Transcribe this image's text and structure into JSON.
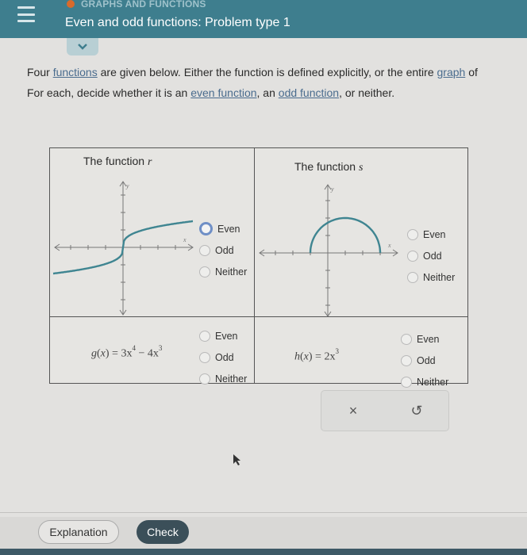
{
  "header": {
    "topic": "GRAPHS AND FUNCTIONS",
    "title": "Even and odd functions: Problem type 1",
    "menu_icon": "hamburger-menu-icon",
    "collapse_icon": "chevron-down-icon"
  },
  "intro": {
    "line1_pre": "Four ",
    "line1_link1": "functions",
    "line1_mid": " are given below. Either the function is defined explicitly, or the entire ",
    "line1_link2": "graph",
    "line1_post": " of",
    "line2_pre": "For each, decide whether it is an ",
    "line2_link1": "even function",
    "line2_mid": ", an ",
    "line2_link2": "odd function",
    "line2_post": ", or neither."
  },
  "problems": [
    {
      "label": "The function ",
      "var": "r",
      "type": "graph",
      "graph_description": "cube-root-like increasing curve through origin",
      "choices": [
        "Even",
        "Odd",
        "Neither"
      ],
      "focused_choice": "Even",
      "selected": null
    },
    {
      "label": "The function ",
      "var": "s",
      "type": "graph",
      "graph_description": "upper semicircle from x=-1 to x=3, center x=1",
      "choices": [
        "Even",
        "Odd",
        "Neither"
      ],
      "selected": null
    },
    {
      "type": "formula",
      "name": "g",
      "arg": "x",
      "expr": {
        "t1_coef": "3x",
        "t1_exp": "4",
        "op": "−",
        "t2_coef": "4x",
        "t2_exp": "3"
      },
      "choices": [
        "Even",
        "Odd",
        "Neither"
      ],
      "selected": null
    },
    {
      "type": "formula",
      "name": "h",
      "arg": "x",
      "expr": {
        "t1_coef": "2x",
        "t1_exp": "3"
      },
      "choices": [
        "Even",
        "Odd",
        "Neither"
      ],
      "selected": null
    }
  ],
  "graph_labels": {
    "x": "x",
    "y": "y"
  },
  "actions": {
    "clear_icon": "×",
    "reset_icon": "↺"
  },
  "footer": {
    "explanation_label": "Explanation",
    "check_label": "Check"
  },
  "colors": {
    "header": "#3e7e8e",
    "curve": "#3f8591",
    "check": "#3b4f59",
    "link": "#4a6c8e",
    "topic_dot": "#d96a2b"
  }
}
